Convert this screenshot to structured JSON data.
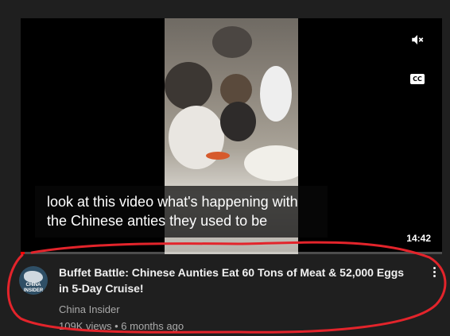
{
  "video": {
    "caption_lines": [
      "look at this video what's happening with",
      "the Chinese anties they used to be"
    ],
    "duration": "14:42",
    "progress_fraction": 0.01,
    "mute_icon": "volume-muted-icon",
    "cc_icon": "closed-captions-icon",
    "cc_label": "CC"
  },
  "details": {
    "title": "Buffet Battle: Chinese Aunties Eat 60 Tons of Meat & 52,000 Eggs in 5-Day Cruise!",
    "channel": "China Insider",
    "views": "109K views",
    "separator": "•",
    "age": "6 months ago",
    "avatar_text": "CHINA INSIDER",
    "more_icon": "more-vert-icon"
  },
  "colors": {
    "background": "#1f1f1f",
    "annotation": "#e3242b",
    "progress": "#ff0000",
    "secondary_text": "#aaaaaa"
  }
}
